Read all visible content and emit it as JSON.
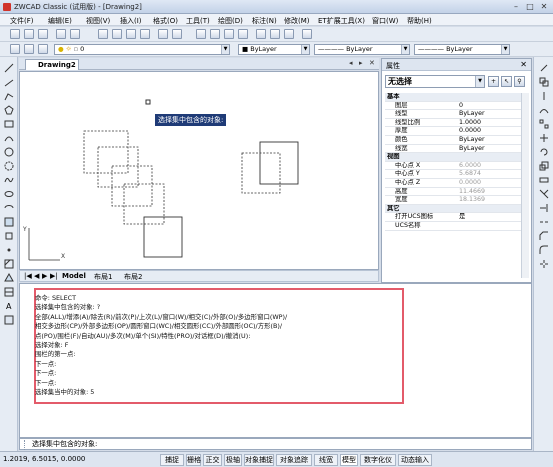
{
  "window": {
    "title": "ZWCAD Classic (试用版) - [Drawing2]"
  },
  "menu": [
    "文件(F)",
    "编辑(E)",
    "视图(V)",
    "插入(I)",
    "格式(O)",
    "工具(T)",
    "绘图(D)",
    "标注(N)",
    "修改(M)",
    "ET扩展工具(X)",
    "窗口(W)",
    "帮助(H)"
  ],
  "toolbar": {
    "layer_value": "0",
    "color_value": "ByLayer",
    "linetype_value": "ByLayer",
    "lineweight_value": "ByLayer"
  },
  "document": {
    "tab": "Drawing2"
  },
  "canvas": {
    "prompt_tooltip": "选择集中包含的对象:"
  },
  "layout_tabs": [
    "Model",
    "布局1",
    "布局2"
  ],
  "properties": {
    "title": "属性",
    "selection": "无选择",
    "rows": [
      {
        "section": true,
        "key": "基本"
      },
      {
        "key": "图层",
        "value": "0"
      },
      {
        "key": "线型",
        "value": "ByLayer"
      },
      {
        "key": "线型比例",
        "value": "1.0000"
      },
      {
        "key": "厚度",
        "value": "0.0000"
      },
      {
        "key": "颜色",
        "value": "ByLayer"
      },
      {
        "key": "线宽",
        "value": "ByLayer"
      },
      {
        "section": true,
        "key": "视图"
      },
      {
        "key": "中心点 X",
        "value": "6.0000",
        "dim": true
      },
      {
        "key": "中心点 Y",
        "value": "5.6874",
        "dim": true
      },
      {
        "key": "中心点 Z",
        "value": "0.0000",
        "dim": true
      },
      {
        "key": "高度",
        "value": "11.4669",
        "dim": true
      },
      {
        "key": "宽度",
        "value": "18.1369",
        "dim": true
      },
      {
        "section": true,
        "key": "其它"
      },
      {
        "key": "打开UCS图标",
        "value": "是"
      },
      {
        "key": "UCS名称",
        "value": ""
      }
    ]
  },
  "command_history": [
    "命令: SELECT",
    "选择集中包含的对象: ?",
    "全部(ALL)/增添(A)/除去(R)/前次(P)/上次(L)/窗口(W)/相交(C)/外部(O)/多边形窗口(WP)/",
    "相交多边形(CP)/外部多边形(OP)/圆形窗口(WC)/相交圆形(CC)/外部圆形(OC)/方形(B)/",
    "点(PO)/围栏(F)/自动(AU)/多次(M)/单个(SI)/特性(PRO)/对话框(D)/撤消(U):",
    "选择对象: F",
    "围栏的第一点:",
    "下一点:",
    "下一点:",
    "下一点:",
    "选择集当中的对象: 5"
  ],
  "command_prompt": "选择集中包含的对象:",
  "status": {
    "coords": "1.2019, 6.5015, 0.0000",
    "buttons": [
      "捕捉",
      "栅格",
      "正交",
      "极轴",
      "对象捕捉",
      "对象追踪",
      "线宽",
      "模型",
      "数字化仪",
      "动态输入"
    ]
  }
}
